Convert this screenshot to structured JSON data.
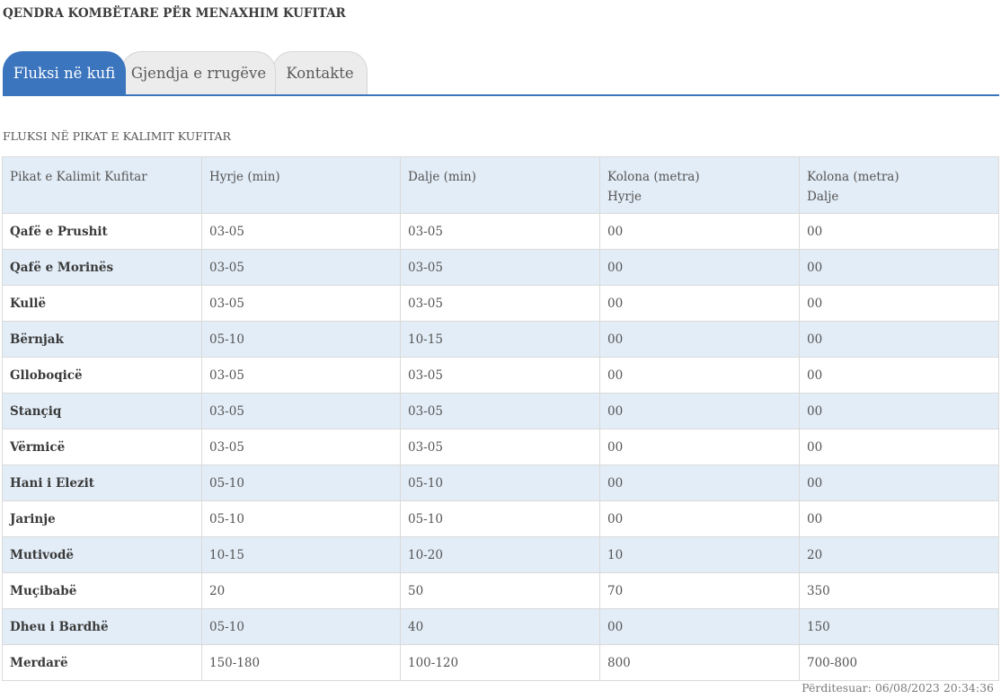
{
  "header": {
    "title": "QENDRA KOMBËTARE PËR MENAXHIM KUFITAR"
  },
  "tabs": [
    {
      "label": "Fluksi në kufi",
      "active": true
    },
    {
      "label": "Gjendja e rrugëve",
      "active": false
    },
    {
      "label": "Kontakte",
      "active": false
    }
  ],
  "section": {
    "title": "FLUKSI NË PIKAT E KALIMIT KUFITAR"
  },
  "table": {
    "headers": [
      {
        "line1": "Pikat e Kalimit Kufitar",
        "line2": ""
      },
      {
        "line1": "Hyrje (min)",
        "line2": ""
      },
      {
        "line1": "Dalje (min)",
        "line2": ""
      },
      {
        "line1": "Kolona (metra)",
        "line2": "Hyrje"
      },
      {
        "line1": "Kolona (metra)",
        "line2": "Dalje"
      }
    ],
    "rows": [
      [
        "Qafë e Prushit",
        "03-05",
        "03-05",
        "00",
        "00"
      ],
      [
        "Qafë e Morinës",
        "03-05",
        "03-05",
        "00",
        "00"
      ],
      [
        "Kullë",
        "03-05",
        "03-05",
        "00",
        "00"
      ],
      [
        "Bërnjak",
        "05-10",
        "10-15",
        "00",
        "00"
      ],
      [
        "Glloboqicë",
        "03-05",
        "03-05",
        "00",
        "00"
      ],
      [
        "Stançiq",
        "03-05",
        "03-05",
        "00",
        "00"
      ],
      [
        "Vërmicë",
        "03-05",
        "03-05",
        "00",
        "00"
      ],
      [
        "Hani i Elezit",
        "05-10",
        "05-10",
        "00",
        "00"
      ],
      [
        "Jarinje",
        "05-10",
        "05-10",
        "00",
        "00"
      ],
      [
        "Mutivodë",
        "10-15",
        "10-20",
        "10",
        "20"
      ],
      [
        "Muçibabë",
        "20",
        "50",
        "70",
        "350"
      ],
      [
        "Dheu i Bardhë",
        "05-10",
        "40",
        "00",
        "150"
      ],
      [
        "Merdarë",
        "150-180",
        "100-120",
        "800",
        "700-800"
      ]
    ]
  },
  "footer": {
    "updated": "Përditesuar: 06/08/2023 20:34:36"
  },
  "colors": {
    "accent": "#3b75be",
    "row_alt": "#e3edf7",
    "tab_inactive": "#ececec"
  }
}
